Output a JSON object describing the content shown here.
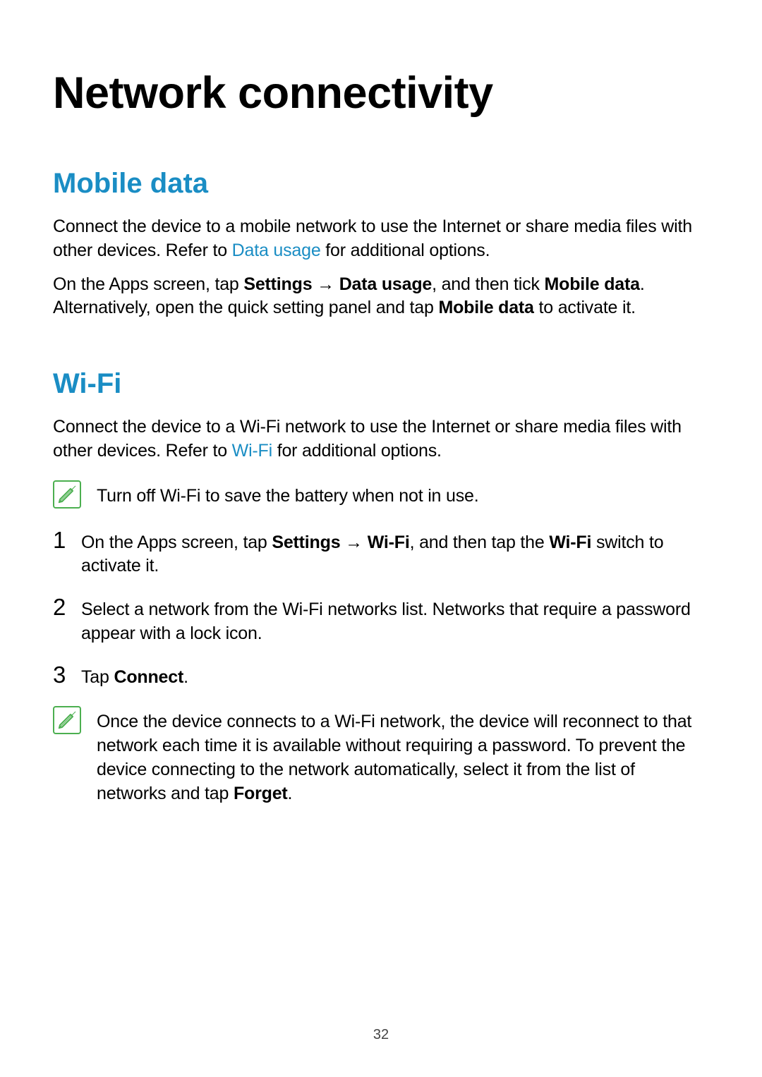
{
  "page_number": "32",
  "title": "Network connectivity",
  "sections": {
    "mobile_data": {
      "heading": "Mobile data",
      "p1_pre": "Connect the device to a mobile network to use the Internet or share media files with other devices. Refer to ",
      "p1_link": "Data usage",
      "p1_post": " for additional options.",
      "p2_a": "On the Apps screen, tap ",
      "p2_b": "Settings",
      "p2_arrow": " → ",
      "p2_c": "Data usage",
      "p2_d": ", and then tick ",
      "p2_e": "Mobile data",
      "p2_f": ". Alternatively, open the quick setting panel and tap ",
      "p2_g": "Mobile data",
      "p2_h": " to activate it."
    },
    "wifi": {
      "heading": "Wi-Fi",
      "p1_pre": "Connect the device to a Wi-Fi network to use the Internet or share media files with other devices. Refer to ",
      "p1_link": "Wi-Fi",
      "p1_post": " for additional options.",
      "note1": "Turn off Wi-Fi to save the battery when not in use.",
      "step1_a": "On the Apps screen, tap ",
      "step1_b": "Settings",
      "step1_arrow": " → ",
      "step1_c": "Wi-Fi",
      "step1_d": ", and then tap the ",
      "step1_e": "Wi-Fi",
      "step1_f": " switch to activate it.",
      "step2": "Select a network from the Wi-Fi networks list. Networks that require a password appear with a lock icon.",
      "step3_a": "Tap ",
      "step3_b": "Connect",
      "step3_c": ".",
      "note2_a": "Once the device connects to a Wi-Fi network, the device will reconnect to that network each time it is available without requiring a password. To prevent the device connecting to the network automatically, select it from the list of networks and tap ",
      "note2_b": "Forget",
      "note2_c": "."
    }
  }
}
